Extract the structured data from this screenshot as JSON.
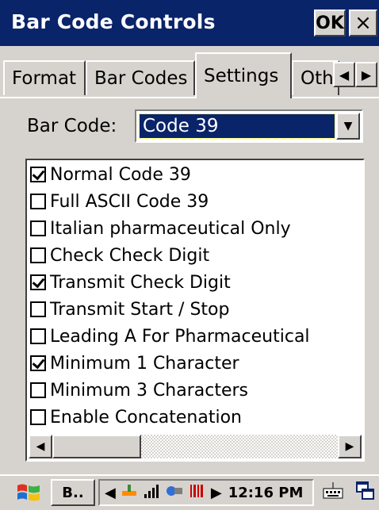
{
  "window": {
    "title": "Bar Code Controls",
    "ok_label": "OK",
    "close_label": "×"
  },
  "tabs": [
    {
      "label": "Format",
      "active": false
    },
    {
      "label": "Bar Codes",
      "active": false
    },
    {
      "label": "Settings",
      "active": true
    },
    {
      "label": "Oth",
      "active": false
    }
  ],
  "tab_arrows": {
    "left": "◀",
    "right": "▶"
  },
  "barcode": {
    "label": "Bar Code:",
    "selected": "Code 39",
    "dropdown_glyph": "▼"
  },
  "options": [
    {
      "label": "Normal Code 39",
      "checked": true
    },
    {
      "label": "Full ASCII Code 39",
      "checked": false
    },
    {
      "label": "Italian pharmaceutical Only",
      "checked": false
    },
    {
      "label": "Check Check Digit",
      "checked": false
    },
    {
      "label": "Transmit Check Digit",
      "checked": true
    },
    {
      "label": "Transmit Start / Stop",
      "checked": false
    },
    {
      "label": "Leading A For Pharmaceutical",
      "checked": false
    },
    {
      "label": "Minimum 1 Character",
      "checked": true
    },
    {
      "label": "Minimum 3 Characters",
      "checked": false
    },
    {
      "label": "Enable Concatenation",
      "checked": false
    }
  ],
  "scrollbar": {
    "left": "◀",
    "right": "▶"
  },
  "taskbar": {
    "start_icon": "windows-flag-icon",
    "task_label": "B..",
    "tray_icons": [
      "◀",
      "network-icon",
      "signal-icon",
      "sync-icon",
      "barcode-icon",
      "▶"
    ],
    "clock": "12:16 PM",
    "keyboard_icon": "keyboard-icon",
    "window_icon": "window-switch-icon"
  }
}
